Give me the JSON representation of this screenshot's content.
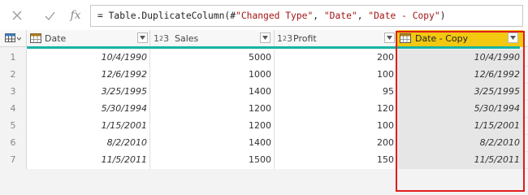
{
  "formula_bar": {
    "fx_label": "fx",
    "formula_prefix": "= Table.DuplicateColumn(#",
    "arg1": "\"Changed Type\"",
    "sep1": ", ",
    "arg2": "\"Date\"",
    "sep2": ", ",
    "arg3": "\"Date - Copy\"",
    "formula_suffix": ")"
  },
  "table": {
    "columns": [
      {
        "name": "Date",
        "type_icon": "calendar-icon"
      },
      {
        "name": "Sales",
        "type_icon": "whole-number-icon"
      },
      {
        "name": "Profit",
        "type_icon": "whole-number-icon"
      },
      {
        "name": "Date - Copy",
        "type_icon": "calendar-icon"
      }
    ],
    "type_number_label": "1",
    "type_number_sup": "2",
    "type_number_label2": "3",
    "rows": [
      {
        "num": "1",
        "date": "10/4/1990",
        "sales": "5000",
        "profit": "200",
        "copy": "10/4/1990"
      },
      {
        "num": "2",
        "date": "12/6/1992",
        "sales": "1000",
        "profit": "100",
        "copy": "12/6/1992"
      },
      {
        "num": "3",
        "date": "3/25/1995",
        "sales": "1400",
        "profit": "95",
        "copy": "3/25/1995"
      },
      {
        "num": "4",
        "date": "5/30/1994",
        "sales": "1200",
        "profit": "120",
        "copy": "5/30/1994"
      },
      {
        "num": "5",
        "date": "1/15/2001",
        "sales": "1200",
        "profit": "100",
        "copy": "1/15/2001"
      },
      {
        "num": "6",
        "date": "8/2/2010",
        "sales": "1400",
        "profit": "200",
        "copy": "8/2/2010"
      },
      {
        "num": "7",
        "date": "11/5/2011",
        "sales": "1500",
        "profit": "150",
        "copy": "11/5/2011"
      }
    ]
  },
  "colors": {
    "accent_header": "#f2c811",
    "highlight_border": "#e31b1b",
    "quality_bar": "#18b4a4"
  }
}
